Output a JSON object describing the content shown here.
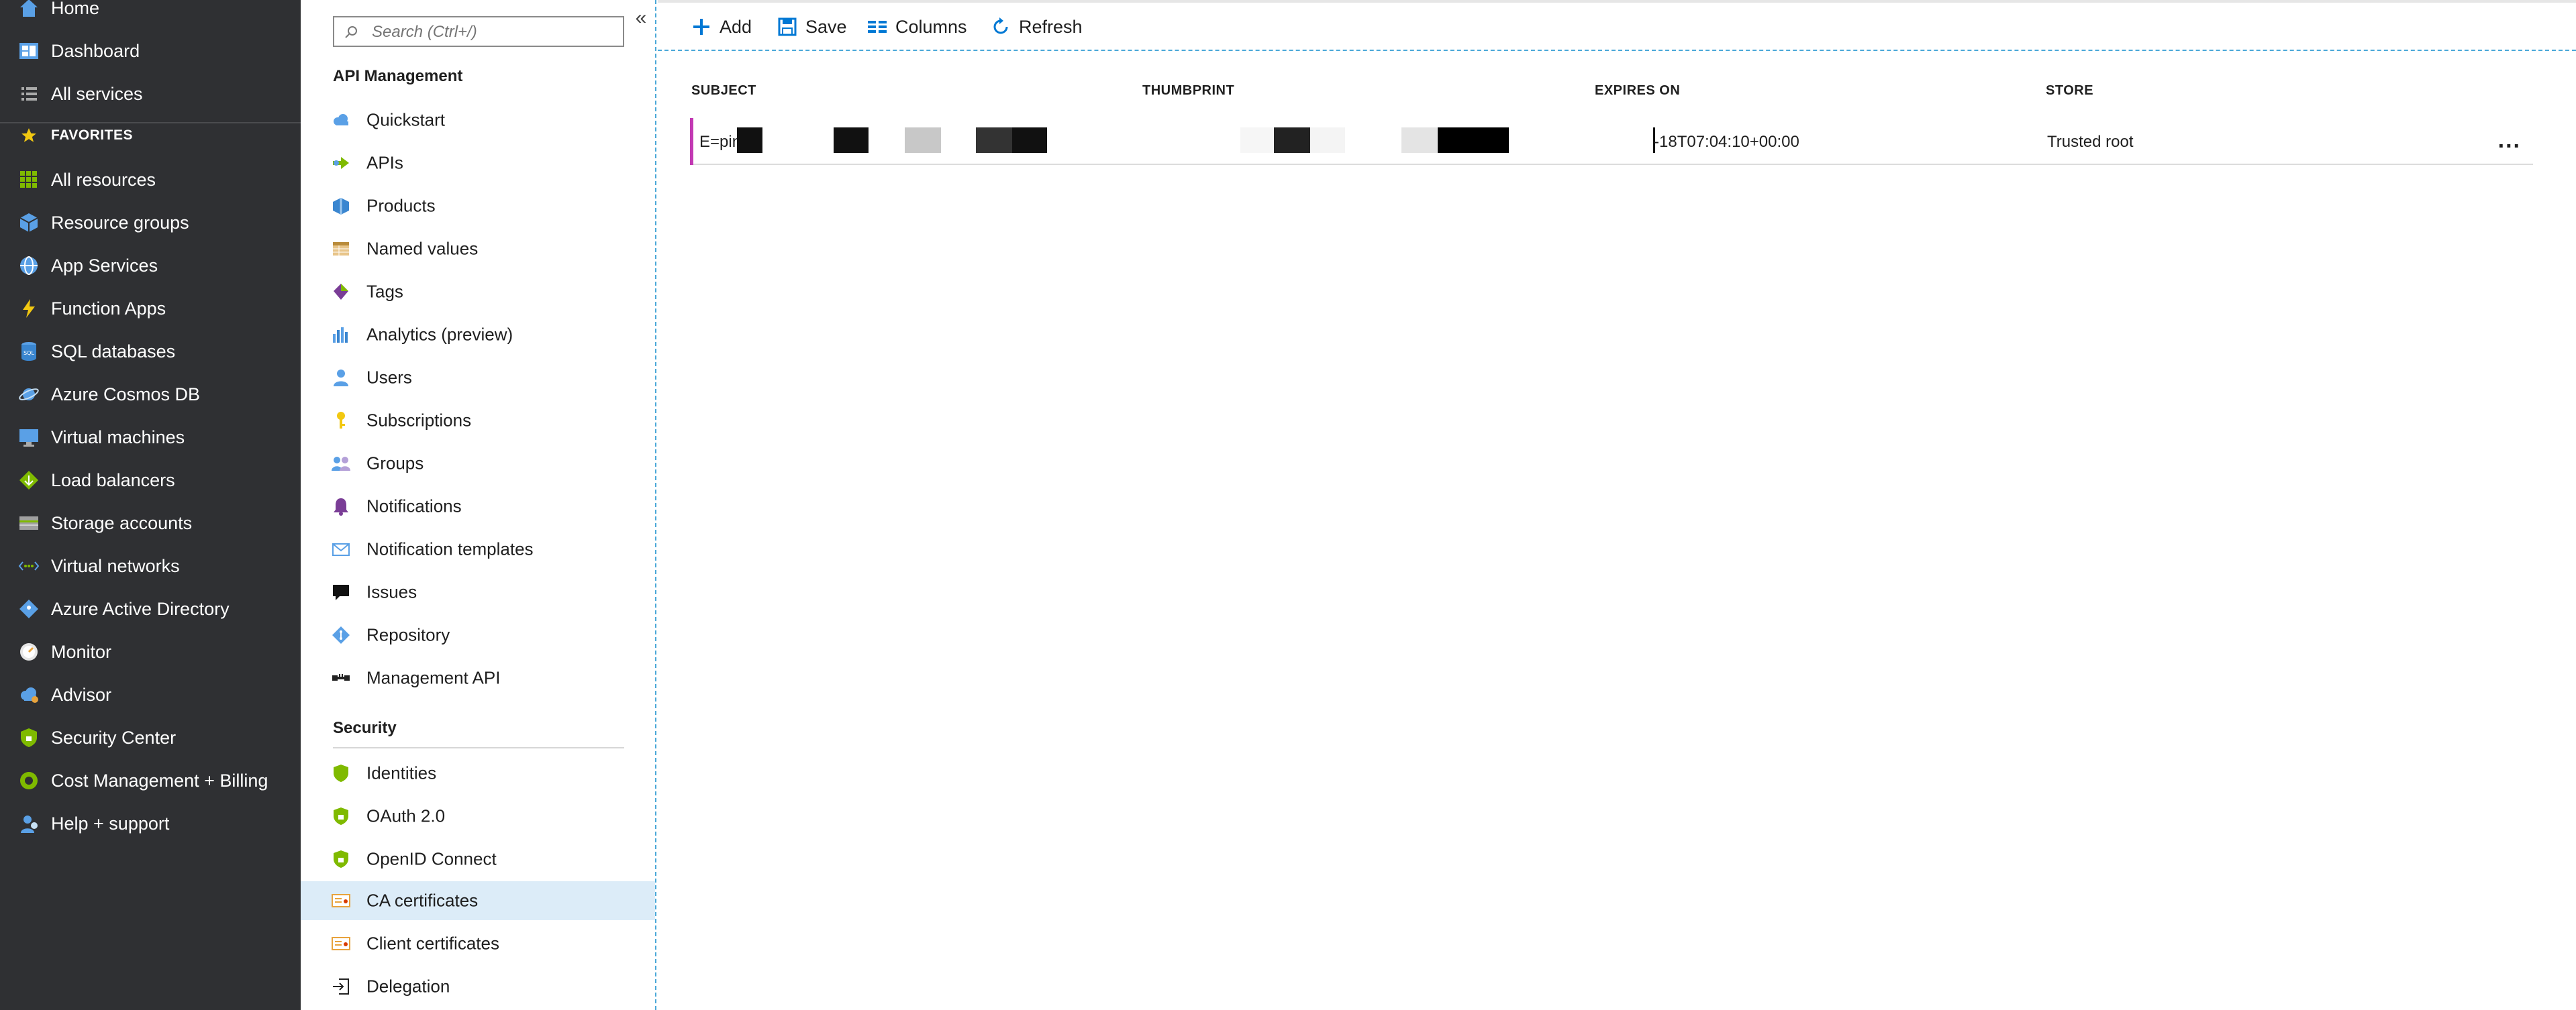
{
  "left_nav": {
    "top": [
      {
        "label": "Home",
        "icon": "home-icon"
      },
      {
        "label": "Dashboard",
        "icon": "dashboard-icon"
      },
      {
        "label": "All services",
        "icon": "list-icon"
      }
    ],
    "favorites_label": "FAVORITES",
    "favorites": [
      {
        "label": "All resources",
        "icon": "grid-icon"
      },
      {
        "label": "Resource groups",
        "icon": "cube-icon"
      },
      {
        "label": "App Services",
        "icon": "globe-icon"
      },
      {
        "label": "Function Apps",
        "icon": "lightning-icon"
      },
      {
        "label": "SQL databases",
        "icon": "database-icon"
      },
      {
        "label": "Azure Cosmos DB",
        "icon": "planet-icon"
      },
      {
        "label": "Virtual machines",
        "icon": "monitor-icon"
      },
      {
        "label": "Load balancers",
        "icon": "diamond-icon"
      },
      {
        "label": "Storage accounts",
        "icon": "storage-icon"
      },
      {
        "label": "Virtual networks",
        "icon": "network-icon"
      },
      {
        "label": "Azure Active Directory",
        "icon": "directory-icon"
      },
      {
        "label": "Monitor",
        "icon": "gauge-icon"
      },
      {
        "label": "Advisor",
        "icon": "cloud-icon"
      },
      {
        "label": "Security Center",
        "icon": "shield-icon"
      },
      {
        "label": "Cost Management + Billing",
        "icon": "cost-icon"
      },
      {
        "label": "Help + support",
        "icon": "person-icon"
      }
    ]
  },
  "resource_menu": {
    "search_placeholder": "Search (Ctrl+/)",
    "section_api": "API Management",
    "api_items": [
      {
        "label": "Quickstart",
        "icon": "cloud-icon"
      },
      {
        "label": "APIs",
        "icon": "arrow-icon"
      },
      {
        "label": "Products",
        "icon": "cube-icon"
      },
      {
        "label": "Named values",
        "icon": "table-icon"
      },
      {
        "label": "Tags",
        "icon": "tag-icon"
      },
      {
        "label": "Analytics (preview)",
        "icon": "bar-chart-icon"
      },
      {
        "label": "Users",
        "icon": "user-icon"
      },
      {
        "label": "Subscriptions",
        "icon": "key-icon"
      },
      {
        "label": "Groups",
        "icon": "group-icon"
      },
      {
        "label": "Notifications",
        "icon": "bell-icon"
      },
      {
        "label": "Notification templates",
        "icon": "mail-icon"
      },
      {
        "label": "Issues",
        "icon": "chat-icon"
      },
      {
        "label": "Repository",
        "icon": "diamond-icon"
      },
      {
        "label": "Management API",
        "icon": "connector-icon"
      }
    ],
    "section_security": "Security",
    "security_items": [
      {
        "label": "Identities",
        "icon": "shield-icon"
      },
      {
        "label": "OAuth 2.0",
        "icon": "shield-icon"
      },
      {
        "label": "OpenID Connect",
        "icon": "shield-icon"
      },
      {
        "label": "CA certificates",
        "icon": "certificate-icon",
        "selected": true
      },
      {
        "label": "Client certificates",
        "icon": "certificate-icon"
      },
      {
        "label": "Delegation",
        "icon": "signin-icon"
      }
    ]
  },
  "toolbar": {
    "add": "Add",
    "save": "Save",
    "columns": "Columns",
    "refresh": "Refresh"
  },
  "grid": {
    "columns": [
      "SUBJECT",
      "THUMBPRINT",
      "EXPIRES ON",
      "STORE"
    ],
    "rows": [
      {
        "subject": "E=ping",
        "thumbprint": "",
        "expires_on": "-18T07:04:10+00:00",
        "store": "Trusted root",
        "actions": "..."
      }
    ]
  },
  "colors": {
    "nav_bg": "#2f3033",
    "accent_blue": "#0078d4",
    "selected_bg": "#dcecf8",
    "row_accent": "#c239b3"
  }
}
